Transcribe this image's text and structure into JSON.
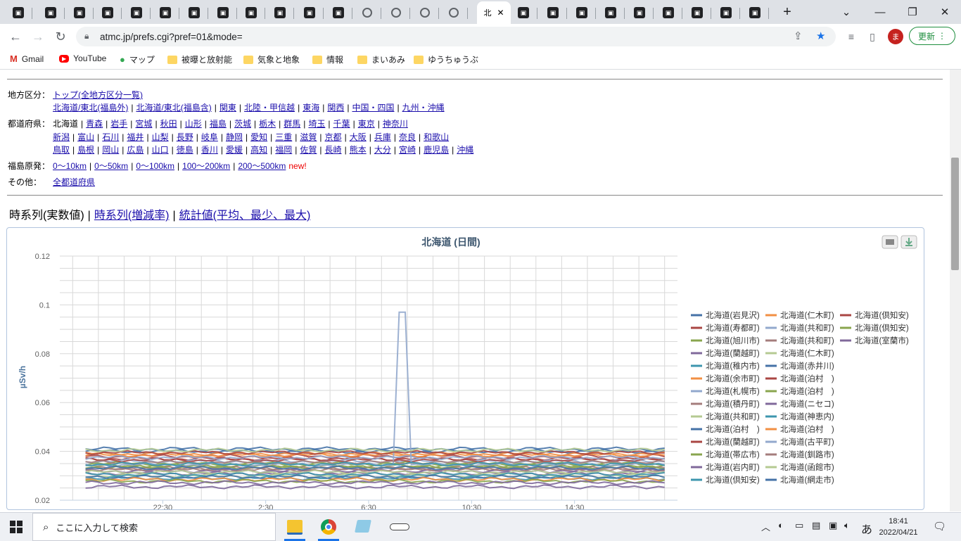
{
  "browser": {
    "active_tab_title": "北",
    "url": "atmc.jp/prefs.cgi?pref=01&mode=",
    "update_label": "更新",
    "avatar_letter": "ま"
  },
  "bookmarks": [
    {
      "label": "Gmail",
      "icon": "gmail-icon"
    },
    {
      "label": "YouTube",
      "icon": "youtube-icon"
    },
    {
      "label": "マップ",
      "icon": "maps-icon"
    },
    {
      "label": "被曝と放射能",
      "icon": "folder-icon"
    },
    {
      "label": "気象と地象",
      "icon": "folder-icon"
    },
    {
      "label": "情報",
      "icon": "folder-icon"
    },
    {
      "label": "まいあみ",
      "icon": "folder-icon"
    },
    {
      "label": "ゆうちゅうぶ",
      "icon": "folder-icon"
    }
  ],
  "nav": {
    "region_label": "地方区分：",
    "region_top": "トップ(全地方区分一覧)",
    "regions": [
      "北海道/東北(福島外)",
      "北海道/東北(福島含)",
      "関東",
      "北陸・甲信越",
      "東海",
      "関西",
      "中国・四国",
      "九州・沖縄"
    ],
    "pref_label": "都道府県：",
    "pref_current": "北海道",
    "prefs_row1": [
      "青森",
      "岩手",
      "宮城",
      "秋田",
      "山形",
      "福島",
      "茨城",
      "栃木",
      "群馬",
      "埼玉",
      "千葉",
      "東京",
      "神奈川"
    ],
    "prefs_row2": [
      "新潟",
      "富山",
      "石川",
      "福井",
      "山梨",
      "長野",
      "岐阜",
      "静岡",
      "愛知",
      "三重",
      "滋賀",
      "京都",
      "大阪",
      "兵庫",
      "奈良",
      "和歌山"
    ],
    "prefs_row3": [
      "鳥取",
      "島根",
      "岡山",
      "広島",
      "山口",
      "徳島",
      "香川",
      "愛媛",
      "高知",
      "福岡",
      "佐賀",
      "長崎",
      "熊本",
      "大分",
      "宮崎",
      "鹿児島",
      "沖縄"
    ],
    "fukushima_label": "福島原発：",
    "fukushima_ranges": [
      "0〜10km",
      "0〜50km",
      "0〜100km",
      "100〜200km",
      "200〜500km"
    ],
    "new_label": "new!",
    "other_label": "その他：",
    "other_link": "全都道府県"
  },
  "view_tabs": {
    "current": "時系列(実数値)",
    "link1": "時系列(増減率)",
    "link2": "統計値(平均、最少、最大)"
  },
  "chart_data": {
    "type": "line",
    "title": "北海道 (日間)",
    "ylabel": "µSv/h",
    "ylim": [
      0.02,
      0.12
    ],
    "yticks": [
      "0.02",
      "0.04",
      "0.06",
      "0.08",
      "0.1",
      "0.12"
    ],
    "xticks": [
      "22:30",
      "2:30",
      "6:30",
      "10:30",
      "14:30"
    ],
    "xrange_hours": [
      18.5,
      42.5
    ],
    "grid": true,
    "legend_placement": "right",
    "series": [
      {
        "name": "北海道(岩見沢)",
        "color": "#4572A7",
        "base": 0.04
      },
      {
        "name": "北海道(仁木町)",
        "color": "#F28F43",
        "base": 0.039
      },
      {
        "name": "北海道(倶知安)",
        "color": "#AA4643",
        "base": 0.038
      },
      {
        "name": "北海道(寿都町)",
        "color": "#AA4643",
        "base": 0.037
      },
      {
        "name": "北海道(共和町)",
        "color": "#92A8CD",
        "base": 0.036
      },
      {
        "name": "北海道(倶知安)",
        "color": "#89A54E",
        "base": 0.035
      },
      {
        "name": "北海道(旭川市)",
        "color": "#89A54E",
        "base": 0.034
      },
      {
        "name": "北海道(共和町)",
        "color": "#A47D7C",
        "base": 0.033
      },
      {
        "name": "北海道(室蘭市)",
        "color": "#80699B",
        "base": 0.032
      },
      {
        "name": "北海道(蘭越町)",
        "color": "#80699B",
        "base": 0.031
      },
      {
        "name": "北海道(仁木町)",
        "color": "#B5CA92",
        "base": 0.03
      },
      {
        "name": "北海道(稚内市)",
        "color": "#3D96AE",
        "base": 0.029
      },
      {
        "name": "北海道(赤井川)",
        "color": "#4572A7",
        "base": 0.041
      },
      {
        "name": "北海道(余市町)",
        "color": "#F28F43",
        "base": 0.0385
      },
      {
        "name": "北海道(泊村　)",
        "color": "#AA4643",
        "base": 0.0365
      },
      {
        "name": "北海道(札幌市)",
        "color": "#92A8CD",
        "base": 0.0345,
        "spike": [
          31.8,
          0.097
        ]
      },
      {
        "name": "北海道(泊村　)",
        "color": "#89A54E",
        "base": 0.0335
      },
      {
        "name": "北海道(積丹町)",
        "color": "#A47D7C",
        "base": 0.0325
      },
      {
        "name": "北海道(ニセコ)",
        "color": "#80699B",
        "base": 0.0255
      },
      {
        "name": "北海道(共和町)",
        "color": "#B5CA92",
        "base": 0.0315
      },
      {
        "name": "北海道(神恵内)",
        "color": "#3D96AE",
        "base": 0.0305
      },
      {
        "name": "北海道(泊村　)",
        "color": "#4572A7",
        "base": 0.0295
      },
      {
        "name": "北海道(泊村　)",
        "color": "#F28F43",
        "base": 0.0285
      },
      {
        "name": "北海道(蘭越町)",
        "color": "#AA4643",
        "base": 0.0395
      },
      {
        "name": "北海道(古平町)",
        "color": "#92A8CD",
        "base": 0.0375
      },
      {
        "name": "北海道(帯広市)",
        "color": "#89A54E",
        "base": 0.0278
      },
      {
        "name": "北海道(釧路市)",
        "color": "#A47D7C",
        "base": 0.0355
      },
      {
        "name": "北海道(岩内町)",
        "color": "#80699B",
        "base": 0.0272
      },
      {
        "name": "北海道(函館市)",
        "color": "#B5CA92",
        "base": 0.0405
      },
      {
        "name": "北海道(倶知安)",
        "color": "#3D96AE",
        "base": 0.0348
      },
      {
        "name": "北海道(網走市)",
        "color": "#4572A7",
        "base": 0.0332
      }
    ]
  },
  "taskbar": {
    "search_placeholder": "ここに入力して検索",
    "ime": "あ",
    "time": "18:41",
    "date": "2022/04/21"
  }
}
